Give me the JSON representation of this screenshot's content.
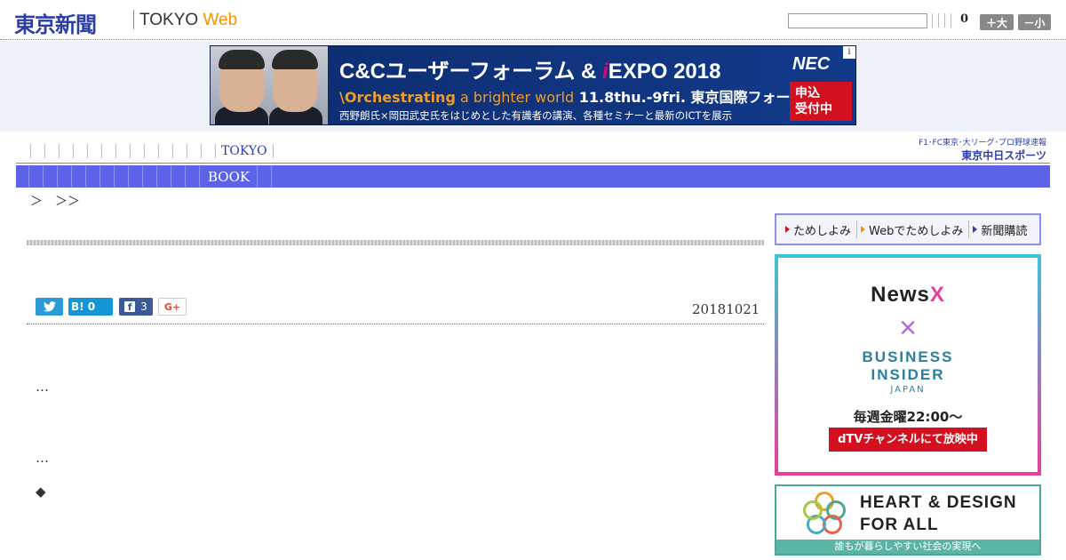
{
  "header": {
    "logo_jp": "東京新聞",
    "logo_en_tokyo": "TOKYO",
    "logo_en_web": "Web",
    "search_value": "",
    "count": "0",
    "font_larger": "＋大",
    "font_smaller": "－小"
  },
  "banner": {
    "title_main": "C&Cユーザーフォーラム & ",
    "title_i": "i",
    "title_expo": "EXPO 2018",
    "sub_orch": "\\Orchestrating",
    "sub_brighter": " a brighter world",
    "sub_date": "  11.8thu.-9fri.  東京国際フォーラム",
    "desc": "西野朗氏×岡田武史氏をはじめとした有識者の講演、各種セミナーと最新のICTを展示",
    "brand": "NEC",
    "cta_line1": "申込",
    "cta_line2": "受付中",
    "info": "i"
  },
  "nav": {
    "row1_label": "TOKYO",
    "row2_label": "BOOK",
    "chunichi_line1": "F1･FC東京･大リーグ･プロ野球速報",
    "chunichi_line2": "東京中日スポーツ"
  },
  "breadcrumb": "＞　＞＞",
  "article": {
    "date": "20181021",
    "line1": "…",
    "line2": "…",
    "line3": "◆"
  },
  "share": {
    "twitter_icon_label": "🐦",
    "hatena_label": "B! 0",
    "facebook_f": "f",
    "facebook_count": "3",
    "gplus_label": "G+"
  },
  "sidebar": {
    "tabs": [
      {
        "label": "ためしよみ"
      },
      {
        "label": "Webでためしよみ"
      },
      {
        "label": "新聞購読"
      }
    ],
    "ad_news": {
      "logo_news": "News",
      "logo_x": "X",
      "cross": "×",
      "bi_line1": "BUSINESS",
      "bi_line2": "INSIDER",
      "bi_japan": "JAPAN",
      "weekly": "毎週金曜22:00〜",
      "dtv": "dTVチャンネルにて放映中"
    },
    "ad_heart": {
      "line1": "HEART & DESIGN",
      "line2": "FOR ALL",
      "strip": "誰もが暮らしやすい社会の実現へ"
    }
  },
  "colors": {
    "brand_blue": "#2d3da6",
    "nav_blue": "#5c63e8",
    "accent_orange": "#f29400",
    "nec_red": "#d3101f"
  }
}
